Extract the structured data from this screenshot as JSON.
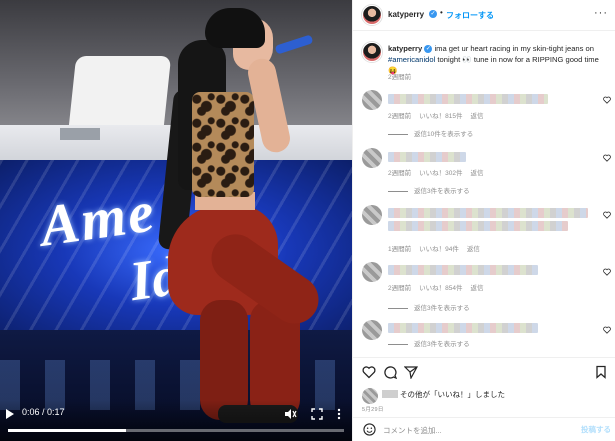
{
  "video": {
    "time": "0:06 / 0:17",
    "progress": 0.35
  },
  "header": {
    "username": "katyperry",
    "verified_glyph": "✓",
    "separator": "•",
    "follow_label": "フォローする",
    "more_glyph": "···"
  },
  "caption": {
    "username": "katyperry",
    "text_before": "ima get ur heart racing in my skin-tight jeans on",
    "hashtag": "#americanidol",
    "text_after": "tonight 👀 tune in now for a RIPPING good time 😝",
    "time": "2週間前"
  },
  "comments": [
    {
      "meta_time": "2週間前",
      "meta_likes": "いいね！815件",
      "meta_reply": "返信",
      "replies_label": "返信10件を表示する"
    },
    {
      "meta_time": "2週間前",
      "meta_likes": "いいね！302件",
      "meta_reply": "返信",
      "replies_label": "返信3件を表示する"
    },
    {
      "meta_time": "1週間前",
      "meta_likes": "いいね！94件",
      "meta_reply": "返信",
      "replies_label": ""
    },
    {
      "meta_time": "2週間前",
      "meta_likes": "いいね！854件",
      "meta_reply": "返信",
      "replies_label": "返信3件を表示する"
    },
    {
      "meta_time": "",
      "meta_likes": "",
      "meta_reply": "",
      "replies_label": "返信3件を表示する"
    }
  ],
  "actions": {
    "likes_text": "その他が「いいね！」しました",
    "date": "5月29日"
  },
  "composer": {
    "placeholder": "コメントを追加...",
    "post_label": "投稿する"
  },
  "colors": {
    "accent": "#0095f6",
    "verified": "#3897f0",
    "muted": "#8e8e8e"
  }
}
